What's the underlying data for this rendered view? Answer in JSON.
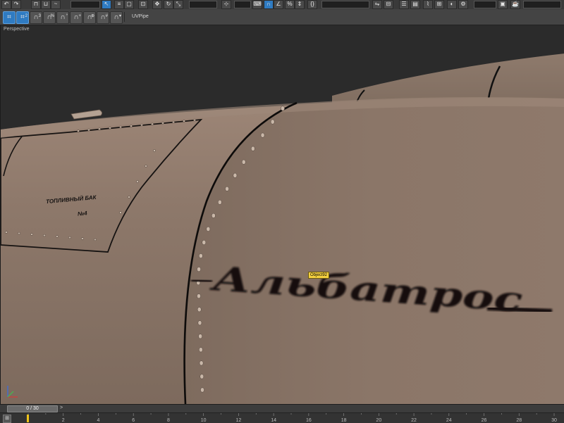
{
  "viewport": {
    "label": "Perspective",
    "tooltip": "Object92"
  },
  "ribbon": {
    "tool_label": "UVPipe",
    "buttons": [
      {
        "icon": "snap-toggle-icon",
        "glyph": "⌗",
        "active": true
      },
      {
        "icon": "snap-2-5d-icon",
        "glyph": "⌗",
        "sup": "2",
        "active": true
      },
      {
        "icon": "snap-3d-icon",
        "glyph": "∩",
        "sup": "3",
        "active": false
      },
      {
        "icon": "angle-snap-icon",
        "glyph": "∩",
        "sup": "%",
        "active": false
      },
      {
        "icon": "percent-snap-icon",
        "glyph": "∩",
        "sup": "°",
        "active": false
      },
      {
        "icon": "spinner-snap-icon",
        "glyph": "∩",
        "sup": "+",
        "active": false
      },
      {
        "icon": "vertex-snap-icon",
        "glyph": "∩",
        "sup": "⊕",
        "active": false
      },
      {
        "icon": "edge-snap-icon",
        "glyph": "∩",
        "sup": "#",
        "active": false
      },
      {
        "icon": "face-snap-icon",
        "glyph": "∩",
        "sup": "▾",
        "active": false
      }
    ]
  },
  "scene_text": {
    "panel_title_line1": "ТОПЛИВНЫЙ БАК",
    "panel_title_line2": "№4",
    "fuselage_name": "Альбатрос"
  },
  "time_slider": {
    "position_text": "0 / 30",
    "arrow": ">"
  },
  "track_bar": {
    "key_icon": "⊞",
    "frame_labels": [
      "2",
      "4",
      "6",
      "8",
      "10",
      "12",
      "14",
      "16",
      "18",
      "20",
      "22",
      "24",
      "26",
      "28",
      "30"
    ]
  },
  "colors": {
    "hull": "#8a7566",
    "hull_light": "#9a8374",
    "hull_dark": "#6f5d50",
    "seam": "#0e0c0b",
    "accent_blue": "#2f7bc2",
    "tooltip_yellow": "#f4d03f",
    "keyframe_yellow": "#f0c419"
  }
}
